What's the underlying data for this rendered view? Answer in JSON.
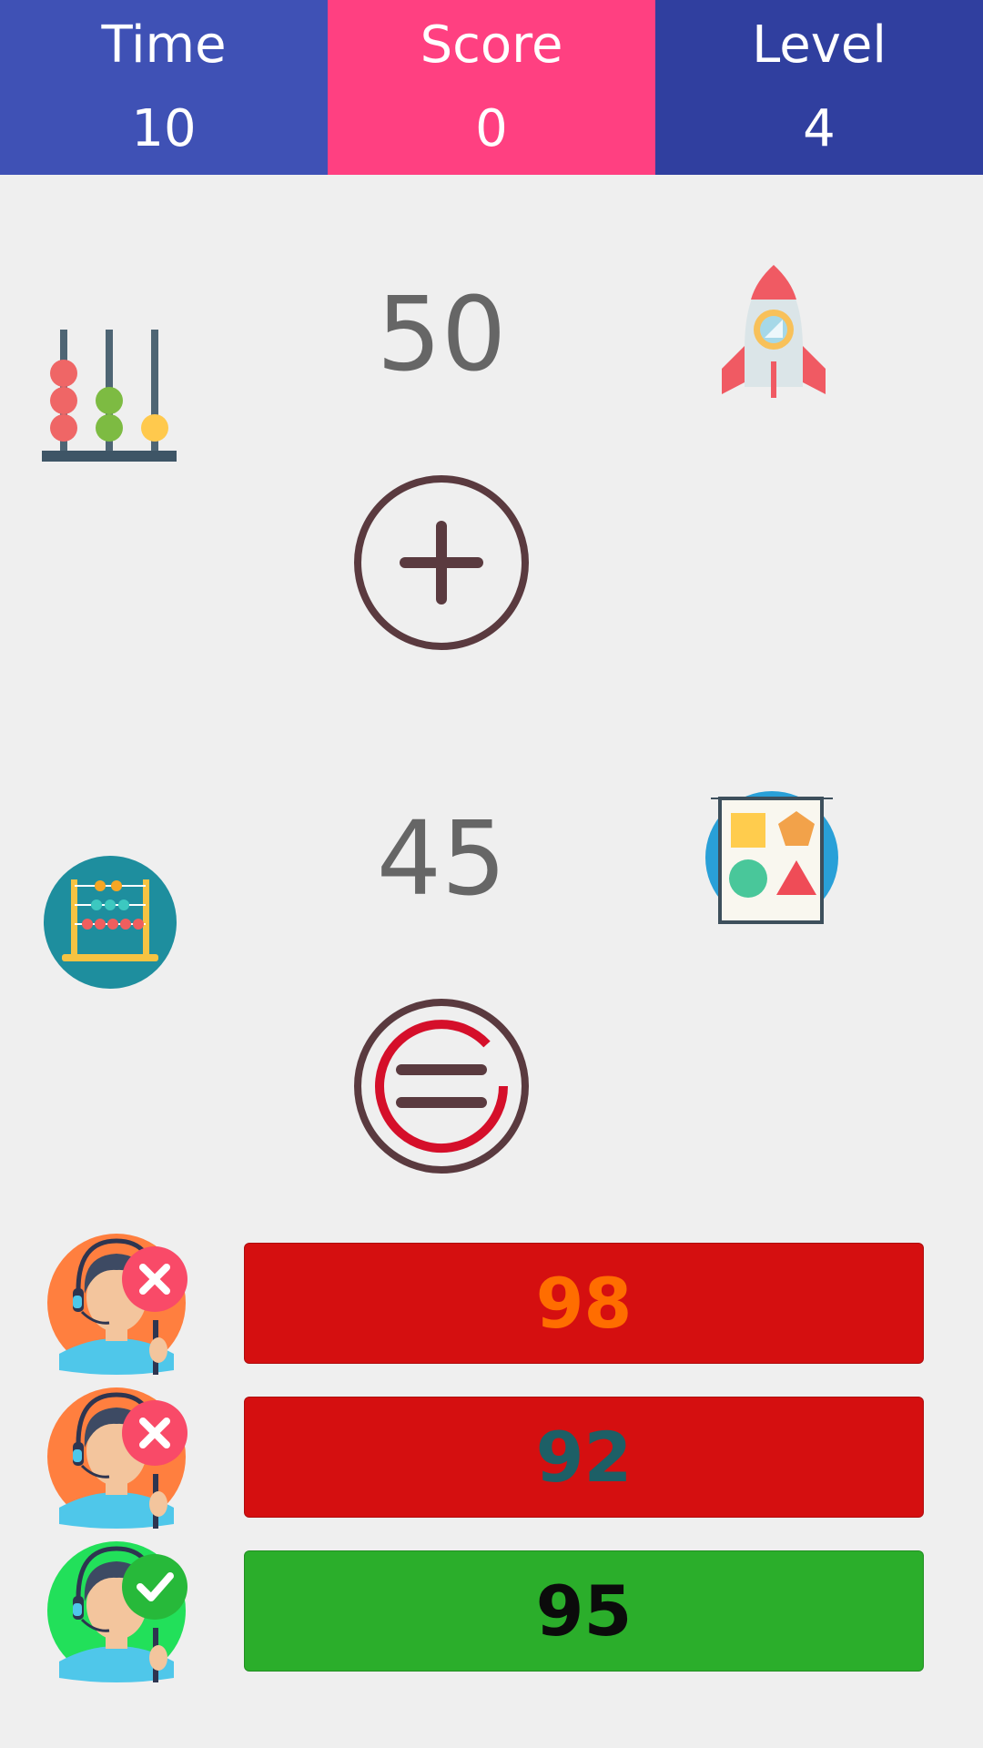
{
  "stats": {
    "time_label": "Time",
    "time_value": "10",
    "score_label": "Score",
    "score_value": "0",
    "level_label": "Level",
    "level_value": "4"
  },
  "problem": {
    "first_number": "50",
    "operator_icon": "plus-circle-icon",
    "second_number": "45",
    "equals_icon": "equals-circle-icon"
  },
  "decor": {
    "top_left": "abacus-icon",
    "top_right": "rocket-icon",
    "mid_left": "abacus-circle-icon",
    "mid_right": "shapes-board-icon"
  },
  "answers": [
    {
      "value": "98",
      "status": "wrong",
      "bg": "#d50f10",
      "text_color": "#ff6d00",
      "avatar_bg": "#ff7f3f",
      "badge": "x-badge-icon"
    },
    {
      "value": "92",
      "status": "wrong",
      "bg": "#d50f10",
      "text_color": "#1d5f66",
      "avatar_bg": "#ff7f3f",
      "badge": "x-badge-icon"
    },
    {
      "value": "95",
      "status": "correct",
      "bg": "#2bae2b",
      "text_color": "#0b0b0b",
      "avatar_bg": "#22e05a",
      "badge": "check-badge-icon"
    }
  ],
  "colors": {
    "time_bg": "#3f51b5",
    "score_bg": "#ff4081",
    "level_bg": "#303f9f",
    "operator_ring": "#5a3a3f",
    "equals_accent": "#d50f2a"
  }
}
